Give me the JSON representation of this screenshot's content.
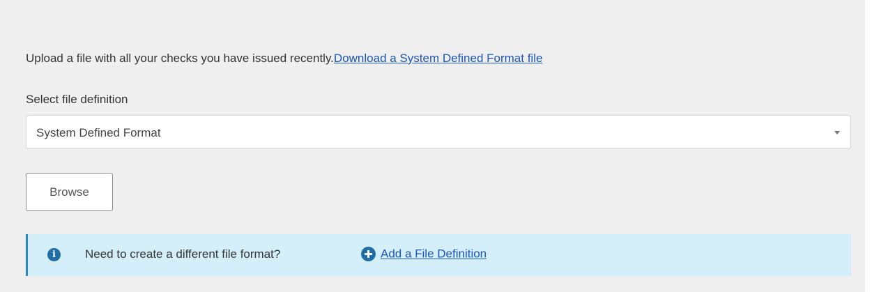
{
  "upload": {
    "intro_text": "Upload a file with all your checks you have issued recently.",
    "download_link": "Download a System Defined Format file"
  },
  "file_definition": {
    "label": "Select file definition",
    "selected_value": "System Defined Format"
  },
  "browse_label": "Browse",
  "info_banner": {
    "icon": "info-icon",
    "message": "Need to create a different file format?",
    "add_icon": "plus-circle-icon",
    "add_link": "Add a File Definition"
  }
}
